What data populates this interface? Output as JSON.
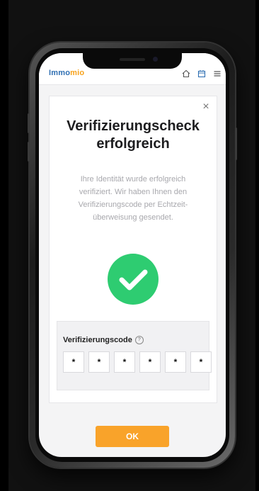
{
  "app": {
    "logo_part1": "Immo",
    "logo_part2": "mio",
    "icons": [
      "home-icon",
      "calendar-icon",
      "menu-icon"
    ]
  },
  "modal": {
    "close_label": "×",
    "title_line1": "Verifizierungscheck",
    "title_line2": "erfolgreich",
    "description": "Ihre Identität wurde erfolgreich verifiziert. Wir haben Ihnen den Verifizierungscode per Echtzeit-überweisung gesendet.",
    "code_label": "Verifizierungscode",
    "help_symbol": "?",
    "code_digits": [
      "*",
      "*",
      "*",
      "*",
      "*",
      "*"
    ],
    "ok_label": "OK"
  },
  "colors": {
    "brand_blue": "#2f6fb2",
    "brand_orange": "#f7a21b",
    "success_green": "#2ecc71",
    "button_orange": "#f9a32a"
  }
}
